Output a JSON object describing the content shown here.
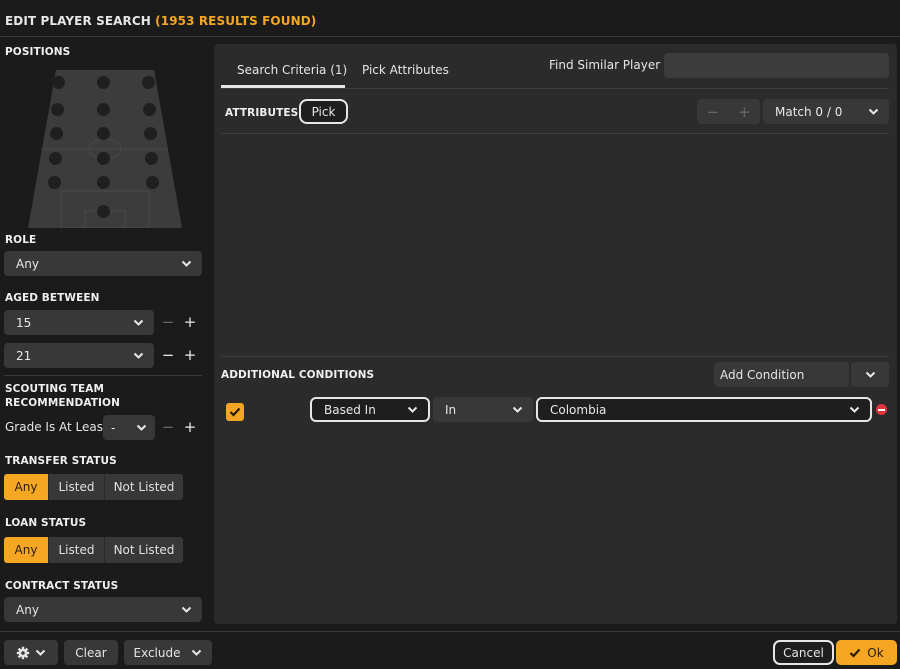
{
  "header": {
    "title": "EDIT PLAYER SEARCH",
    "results": "(1953 RESULTS FOUND)"
  },
  "sidebar": {
    "positions_label": "POSITIONS",
    "role_label": "ROLE",
    "role_value": "Any",
    "aged_label": "AGED BETWEEN",
    "age_min": "15",
    "age_max": "21",
    "scouting_label": "SCOUTING TEAM RECOMMENDATION",
    "grade_label": "Grade Is At Least",
    "grade_value": "-",
    "transfer_label": "TRANSFER STATUS",
    "transfer_options": [
      "Any",
      "Listed",
      "Not Listed"
    ],
    "loan_label": "LOAN STATUS",
    "loan_options": [
      "Any",
      "Listed",
      "Not Listed"
    ],
    "contract_label": "CONTRACT STATUS",
    "contract_value": "Any"
  },
  "tabs": {
    "search_criteria": "Search Criteria (1)",
    "pick_attributes": "Pick Attributes",
    "find_similar": "Find Similar Player to"
  },
  "attributes": {
    "label": "ATTRIBUTES",
    "pick": "Pick",
    "match": "Match 0 / 0"
  },
  "conditions": {
    "label": "ADDITIONAL CONDITIONS",
    "add_condition": "Add Condition",
    "field": "Based In",
    "operator": "In",
    "value": "Colombia"
  },
  "footer": {
    "clear": "Clear",
    "exclude": "Exclude",
    "cancel": "Cancel",
    "ok": "Ok"
  },
  "colors": {
    "accent": "#f5a623",
    "panel": "#2b2b2b",
    "background": "#1b1b1b",
    "remove": "#e0333c"
  }
}
